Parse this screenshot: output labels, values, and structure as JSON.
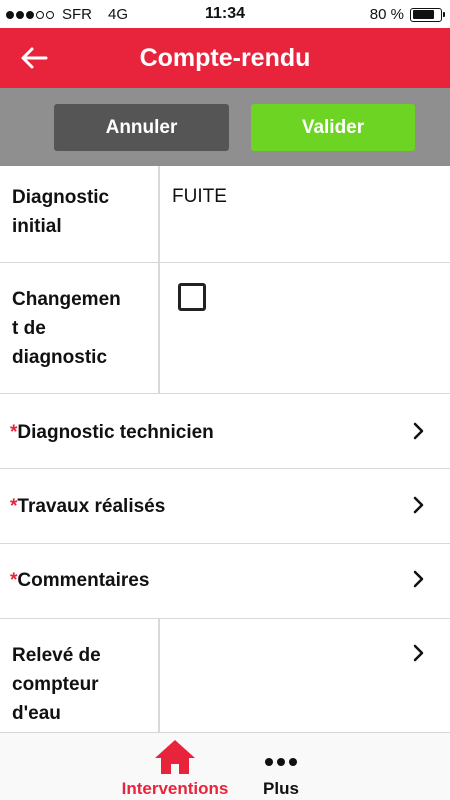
{
  "status_bar": {
    "carrier": "SFR",
    "network": "4G",
    "time": "11:34",
    "battery": "80 %",
    "battery_level": 0.8,
    "signal_bars_filled": 3,
    "signal_bars_total": 5
  },
  "header": {
    "title": "Compte-rendu",
    "back_icon": "arrow-left-icon",
    "color": "#e8243d"
  },
  "actions": {
    "cancel_label": "Annuler",
    "validate_label": "Valider",
    "cancel_color": "#555555",
    "validate_color": "#6dd423"
  },
  "form": {
    "diagnostic_initial": {
      "label_line1": "Diagnostic",
      "label_line2": "initial",
      "value": "FUITE"
    },
    "changement": {
      "label_line1": "Changemen",
      "label_line2": "t de",
      "label_line3": "diagnostic",
      "checked": false
    },
    "diagnostic_technicien": {
      "required_mark": "*",
      "label": "Diagnostic technicien"
    },
    "travaux": {
      "required_mark": "*",
      "label": "Travaux réalisés"
    },
    "commentaires": {
      "required_mark": "*",
      "label": "Commentaires"
    },
    "releve": {
      "label_line1": "Relevé de",
      "label_line2": "compteur",
      "label_line3": "d'eau"
    }
  },
  "tabbar": {
    "interventions_label": "Interventions",
    "plus_label": "Plus",
    "active_color": "#e8243d"
  }
}
